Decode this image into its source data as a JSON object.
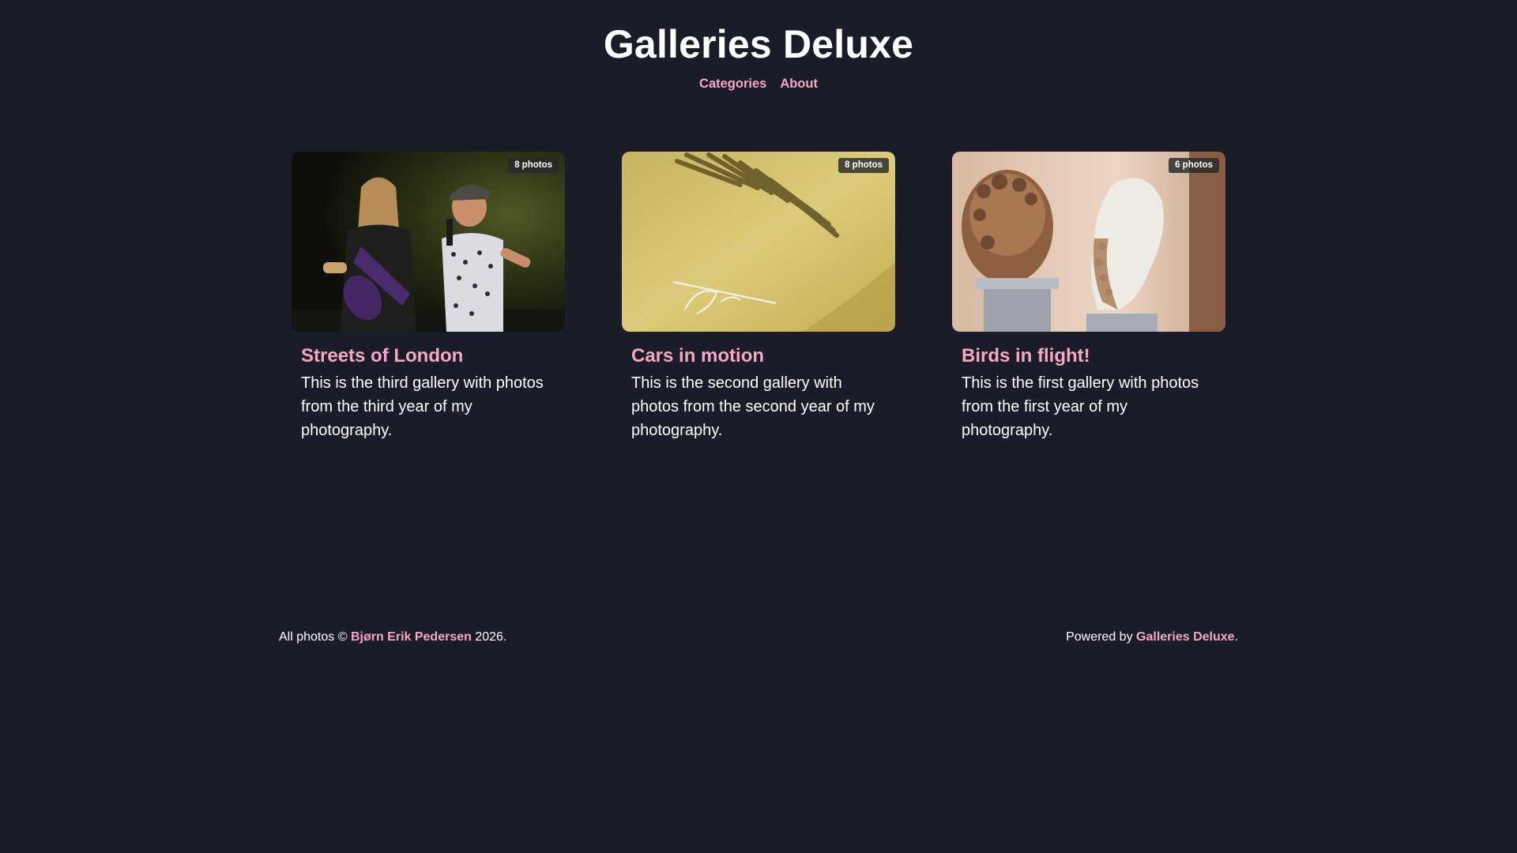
{
  "site": {
    "title": "Galleries Deluxe"
  },
  "nav": {
    "items": [
      {
        "label": "Categories"
      },
      {
        "label": "About"
      }
    ]
  },
  "galleries": [
    {
      "title": "Streets of London",
      "description": "This is the third gallery with photos from the third year of my photography.",
      "count_label": "8 photos",
      "thumbnail": "concert-performers-photo"
    },
    {
      "title": "Cars in motion",
      "description": "This is the second gallery with photos from the second year of my photography.",
      "count_label": "8 photos",
      "thumbnail": "karmann-ghia-car-detail-photo"
    },
    {
      "title": "Birds in flight!",
      "description": "This is the first gallery with photos from the first year of my photography.",
      "count_label": "6 photos",
      "thumbnail": "marble-sculpture-heads-photo"
    }
  ],
  "footer": {
    "copyright_prefix": "All photos ©",
    "author": "Bjørn Erik Pedersen",
    "copyright_suffix": "2026.",
    "powered_prefix": "Powered by",
    "powered_link": "Galleries Deluxe",
    "powered_suffix": "."
  },
  "colors": {
    "background": "#1b1c29",
    "accent": "#f4a9c0",
    "text": "#ffffff"
  }
}
